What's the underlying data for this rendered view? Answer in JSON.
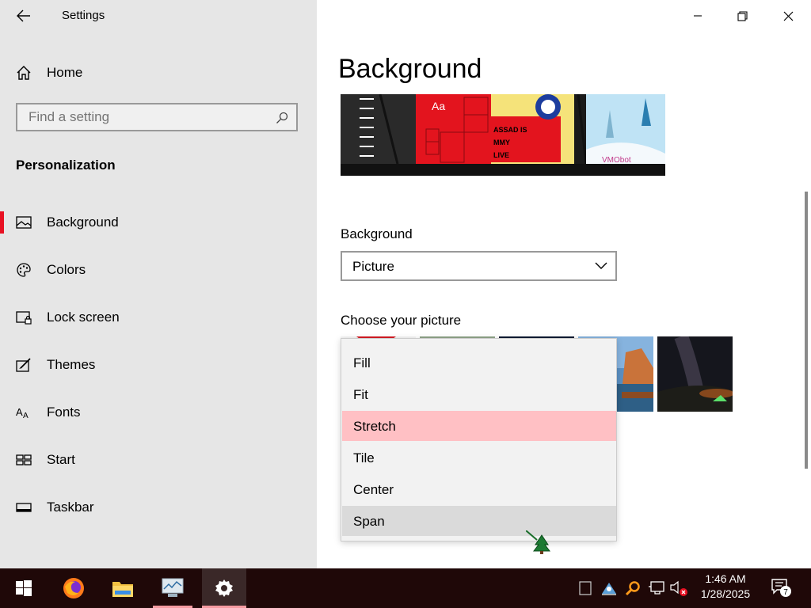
{
  "window": {
    "title": "Settings"
  },
  "sidebar": {
    "home_label": "Home",
    "search_placeholder": "Find a setting",
    "section": "Personalization",
    "items": [
      {
        "label": "Background",
        "icon": "picture-icon",
        "active": true
      },
      {
        "label": "Colors",
        "icon": "palette-icon"
      },
      {
        "label": "Lock screen",
        "icon": "lock-screen-icon"
      },
      {
        "label": "Themes",
        "icon": "themes-icon"
      },
      {
        "label": "Fonts",
        "icon": "fonts-icon"
      },
      {
        "label": "Start",
        "icon": "start-grid-icon"
      },
      {
        "label": "Taskbar",
        "icon": "taskbar-icon"
      }
    ]
  },
  "main": {
    "title": "Background",
    "preview": {
      "sample_text": "Aa",
      "banner_text": "ASSAD IS\nMMY\nLIVE",
      "watermark": "VMObot"
    },
    "background_label": "Background",
    "background_value": "Picture",
    "choose_label": "Choose your picture"
  },
  "fit_dropdown": {
    "options": [
      "Fill",
      "Fit",
      "Stretch",
      "Tile",
      "Center",
      "Span"
    ],
    "selected": "Stretch",
    "hovered": "Span"
  },
  "taskbar": {
    "apps": [
      "windows-start-icon",
      "firefox-icon",
      "file-explorer-icon",
      "resource-monitor-icon",
      "settings-gear-icon"
    ],
    "time": "1:46 AM",
    "date": "1/28/2025",
    "notification_count": "7"
  },
  "colors": {
    "accent": "#e81123",
    "selected_option": "#ffc0c4",
    "hover_option": "#dadada",
    "sidebar_bg": "#e6e6e6",
    "taskbar_bg": "#1f0808"
  }
}
